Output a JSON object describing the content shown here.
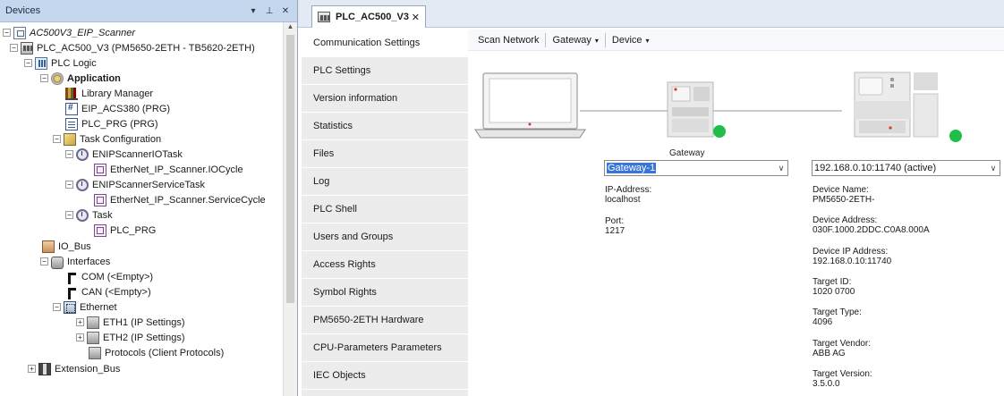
{
  "devices_panel": {
    "title": "Devices",
    "header_buttons": {
      "dropdown": "▾",
      "pin": "⊥",
      "close": "✕"
    },
    "tree": [
      {
        "label": "AC500V3_EIP_Scanner",
        "expander": "−",
        "icon": "project-icon"
      },
      {
        "label": "PLC_AC500_V3 (PM5650-2ETH - TB5620-2ETH)",
        "expander": "−",
        "icon": "plc-icon"
      },
      {
        "label": "PLC Logic",
        "expander": "−",
        "icon": "plc-logic-icon"
      },
      {
        "label": "Application",
        "expander": "−",
        "icon": "application-gear-icon"
      },
      {
        "label": "Library Manager",
        "expander": "",
        "icon": "library-icon"
      },
      {
        "label": "EIP_ACS380 (PRG)",
        "expander": "",
        "icon": "program-icon"
      },
      {
        "label": "PLC_PRG (PRG)",
        "expander": "",
        "icon": "program-doc-icon"
      },
      {
        "label": "Task Configuration",
        "expander": "−",
        "icon": "task-configuration-icon"
      },
      {
        "label": "ENIPScannerIOTask",
        "expander": "−",
        "icon": "task-icon"
      },
      {
        "label": "EtherNet_IP_Scanner.IOCycle",
        "expander": "",
        "icon": "program-call-icon"
      },
      {
        "label": "ENIPScannerServiceTask",
        "expander": "−",
        "icon": "task-icon"
      },
      {
        "label": "EtherNet_IP_Scanner.ServiceCycle",
        "expander": "",
        "icon": "program-call-icon"
      },
      {
        "label": "Task",
        "expander": "−",
        "icon": "task-icon"
      },
      {
        "label": "PLC_PRG",
        "expander": "",
        "icon": "program-call-icon"
      },
      {
        "label": "IO_Bus",
        "expander": "",
        "icon": "io-bus-icon"
      },
      {
        "label": "Interfaces",
        "expander": "−",
        "icon": "interfaces-icon"
      },
      {
        "label": "COM (<Empty>)",
        "expander": "",
        "icon": "com-port-icon"
      },
      {
        "label": "CAN (<Empty>)",
        "expander": "",
        "icon": "can-port-icon"
      },
      {
        "label": "Ethernet",
        "expander": "−",
        "icon": "ethernet-icon"
      },
      {
        "label": "ETH1 (IP Settings)",
        "expander": "+",
        "icon": "eth-port-icon"
      },
      {
        "label": "ETH2 (IP Settings)",
        "expander": "+",
        "icon": "eth-port-icon"
      },
      {
        "label": "Protocols (Client Protocols)",
        "expander": "",
        "icon": "protocols-icon"
      },
      {
        "label": "Extension_Bus",
        "expander": "+",
        "icon": "extension-bus-icon"
      }
    ]
  },
  "editor": {
    "tab": {
      "label": "PLC_AC500_V3",
      "close": "✕"
    },
    "side_tabs": [
      "Communication Settings",
      "PLC Settings",
      "Version information",
      "Statistics",
      "Files",
      "Log",
      "PLC Shell",
      "Users and Groups",
      "Access Rights",
      "Symbol Rights",
      "PM5650-2ETH Hardware",
      "CPU-Parameters Parameters",
      "IEC Objects"
    ],
    "active_side_tab": "Communication Settings",
    "toolbar": {
      "scan_network": "Scan Network",
      "gateway": "Gateway",
      "device": "Device",
      "caret": "▾"
    },
    "diagram": {
      "gateway_caption": "Gateway",
      "status_color": "#1fbf4a"
    },
    "gateway": {
      "selected": "Gateway-1",
      "ip_label": "IP-Address:",
      "ip_value": "localhost",
      "port_label": "Port:",
      "port_value": "1217"
    },
    "device": {
      "selected": "192.168.0.10:11740 (active)",
      "fields": [
        {
          "label": "Device Name:",
          "value": "PM5650-2ETH-"
        },
        {
          "label": "Device Address:",
          "value": "030F.1000.2DDC.C0A8.000A"
        },
        {
          "label": "Device IP Address:",
          "value": "192.168.0.10:11740"
        },
        {
          "label": "Target ID:",
          "value": "1020 0700"
        },
        {
          "label": "Target Type:",
          "value": "4096"
        },
        {
          "label": "Target Vendor:",
          "value": "ABB AG"
        },
        {
          "label": "Target Version:",
          "value": "3.5.0.0"
        }
      ]
    },
    "dropdown_arrow": "∨"
  }
}
